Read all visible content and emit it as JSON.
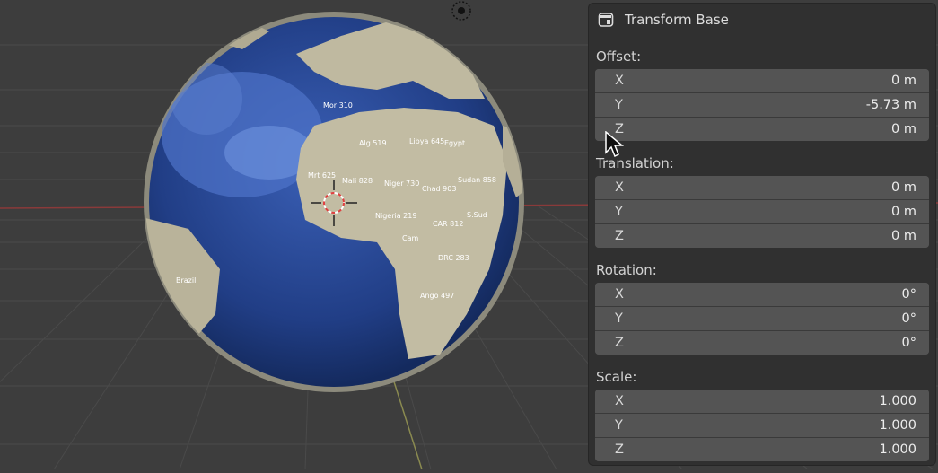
{
  "panel": {
    "title": "Transform Base",
    "sections": [
      {
        "label": "Offset:",
        "fields": [
          {
            "axis": "X",
            "value": "0 m"
          },
          {
            "axis": "Y",
            "value": "-5.73 m"
          },
          {
            "axis": "Z",
            "value": "0 m"
          }
        ]
      },
      {
        "label": "Translation:",
        "fields": [
          {
            "axis": "X",
            "value": "0 m"
          },
          {
            "axis": "Y",
            "value": "0 m"
          },
          {
            "axis": "Z",
            "value": "0 m"
          }
        ]
      },
      {
        "label": "Rotation:",
        "fields": [
          {
            "axis": "X",
            "value": "0°"
          },
          {
            "axis": "Y",
            "value": "0°"
          },
          {
            "axis": "Z",
            "value": "0°"
          }
        ]
      },
      {
        "label": "Scale:",
        "fields": [
          {
            "axis": "X",
            "value": "1.000"
          },
          {
            "axis": "Y",
            "value": "1.000"
          },
          {
            "axis": "Z",
            "value": "1.000"
          }
        ]
      }
    ]
  },
  "globe_labels": [
    "Mali 828",
    "Niger 730",
    "Chad 903",
    "Sudan 858",
    "Nigeria 219",
    "Mrt 625",
    "Alg 519",
    "Libya 645",
    "Egypt",
    "CAR 812",
    "DRC 283",
    "S.Sud",
    "Ango 497",
    "Brazil",
    "Cam",
    "Mor 310"
  ],
  "icons": [
    "panel-icon",
    "3d-cursor-icon",
    "light-gizmo-icon",
    "mouse-pointer-icon"
  ]
}
